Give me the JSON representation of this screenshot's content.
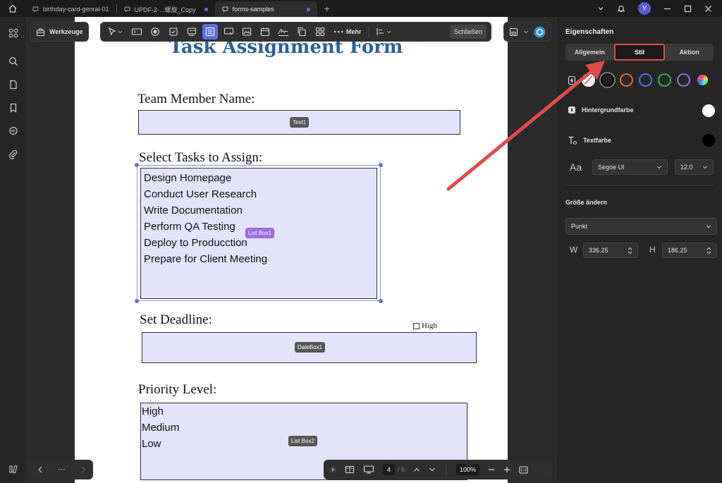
{
  "titlebar": {
    "tabs": [
      {
        "label": "birthday-card-genral-01",
        "active": false,
        "unsaved": false
      },
      {
        "label": "UPDF-2-...螺旋_Copy",
        "active": false,
        "unsaved": true
      },
      {
        "label": "forms-samples",
        "active": true,
        "unsaved": true
      }
    ],
    "avatar_initial": "Y"
  },
  "toolbar": {
    "tools_label": "Werkzeuge",
    "more_label": "Mehr",
    "close_label": "Schließen"
  },
  "document": {
    "title": "Task Assignment Form",
    "team_member_label": "Team Member Name:",
    "text1_tag": "Text1",
    "tasks_label": "Select Tasks to Assign:",
    "tasks": [
      "Design Homepage",
      "Conduct User Research",
      "Write Documentation",
      "Perform QA Testing",
      "Deploy to Producction",
      "Prepare for Client Meeting"
    ],
    "listbox1_tag": "List Box1",
    "deadline_label": "Set Deadline:",
    "high_checkbox_label": "High",
    "datebox1_tag": "DateBox1",
    "priority_label": "Priority Level:",
    "priorities": [
      "High",
      "Medium",
      "Low"
    ],
    "listbox2_tag": "List Box2"
  },
  "bottom_bar": {
    "ellipsis": "···",
    "current_page": "4",
    "total_pages": "/ 6",
    "zoom": "100%"
  },
  "properties": {
    "title": "Eigenschaften",
    "tabs": [
      "Allgemein",
      "Stil",
      "Aktion"
    ],
    "active_tab": "Stil",
    "background_label": "Hintergrundfarbe",
    "text_color_label": "Textfarbe",
    "font_family": "Segoe UI",
    "font_size": "12.0",
    "resize_label": "Größe ändern",
    "unit": "Punkt",
    "width_label": "W",
    "width_value": "336.25",
    "height_label": "H",
    "height_value": "186.25",
    "colors": {
      "border_selected": "#000000",
      "swatch_orange": "#e8643c",
      "swatch_blue": "#5b6fe8",
      "swatch_green": "#2fb24a",
      "swatch_purple": "#9b6be0",
      "background_color": "#ffffff",
      "text_color": "#000000"
    }
  },
  "colors": {
    "accent": "#5b6fe8",
    "annotation_arrow": "#e24b4b",
    "form_field_fill": "#e3e4fb",
    "title_blue": "#2f5e97"
  }
}
